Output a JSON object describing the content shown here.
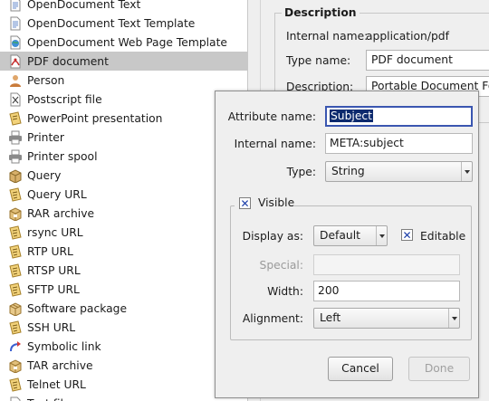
{
  "file_types": [
    {
      "label": "OpenDocument Text",
      "icon": "document-icon"
    },
    {
      "label": "OpenDocument Text Template",
      "icon": "document-icon"
    },
    {
      "label": "OpenDocument Web Page Template",
      "icon": "web-page-icon"
    },
    {
      "label": "PDF document",
      "icon": "pdf-icon",
      "selected": true
    },
    {
      "label": "Person",
      "icon": "person-icon"
    },
    {
      "label": "Postscript file",
      "icon": "postscript-icon"
    },
    {
      "label": "PowerPoint presentation",
      "icon": "presentation-icon"
    },
    {
      "label": "Printer",
      "icon": "printer-icon"
    },
    {
      "label": "Printer spool",
      "icon": "printer-icon"
    },
    {
      "label": "Query",
      "icon": "query-icon"
    },
    {
      "label": "Query URL",
      "icon": "url-icon"
    },
    {
      "label": "RAR archive",
      "icon": "archive-icon"
    },
    {
      "label": "rsync URL",
      "icon": "url-icon"
    },
    {
      "label": "RTP URL",
      "icon": "url-icon"
    },
    {
      "label": "RTSP URL",
      "icon": "url-icon"
    },
    {
      "label": "SFTP URL",
      "icon": "url-icon"
    },
    {
      "label": "Software package",
      "icon": "package-icon"
    },
    {
      "label": "SSH URL",
      "icon": "url-icon"
    },
    {
      "label": "Symbolic link",
      "icon": "symlink-icon"
    },
    {
      "label": "TAR archive",
      "icon": "archive-icon"
    },
    {
      "label": "Telnet URL",
      "icon": "url-icon"
    },
    {
      "label": "Text file",
      "icon": "document-icon"
    }
  ],
  "description_panel": {
    "title": "Description",
    "internal_name_label": "Internal name:",
    "internal_name_value": "application/pdf",
    "type_name_label": "Type name:",
    "type_name_value": "PDF document",
    "description_label": "Description:",
    "description_value": "Portable Document Format"
  },
  "attribute_dialog": {
    "attribute_name_label": "Attribute name:",
    "attribute_name_value": "Subject",
    "internal_name_label": "Internal name:",
    "internal_name_value": "META:subject",
    "type_label": "Type:",
    "type_value": "String",
    "visible_label": "Visible",
    "visible_checked": true,
    "display_as_label": "Display as:",
    "display_as_value": "Default",
    "editable_label": "Editable",
    "editable_checked": true,
    "special_label": "Special:",
    "special_value": "",
    "width_label": "Width:",
    "width_value": "200",
    "alignment_label": "Alignment:",
    "alignment_value": "Left",
    "cancel_label": "Cancel",
    "done_label": "Done"
  },
  "colors": {
    "selection_row": "#c8c8c8",
    "focus_border": "#3a56b0",
    "text_highlight": "#0d2a6e",
    "check_mark": "#1b3ea8"
  }
}
